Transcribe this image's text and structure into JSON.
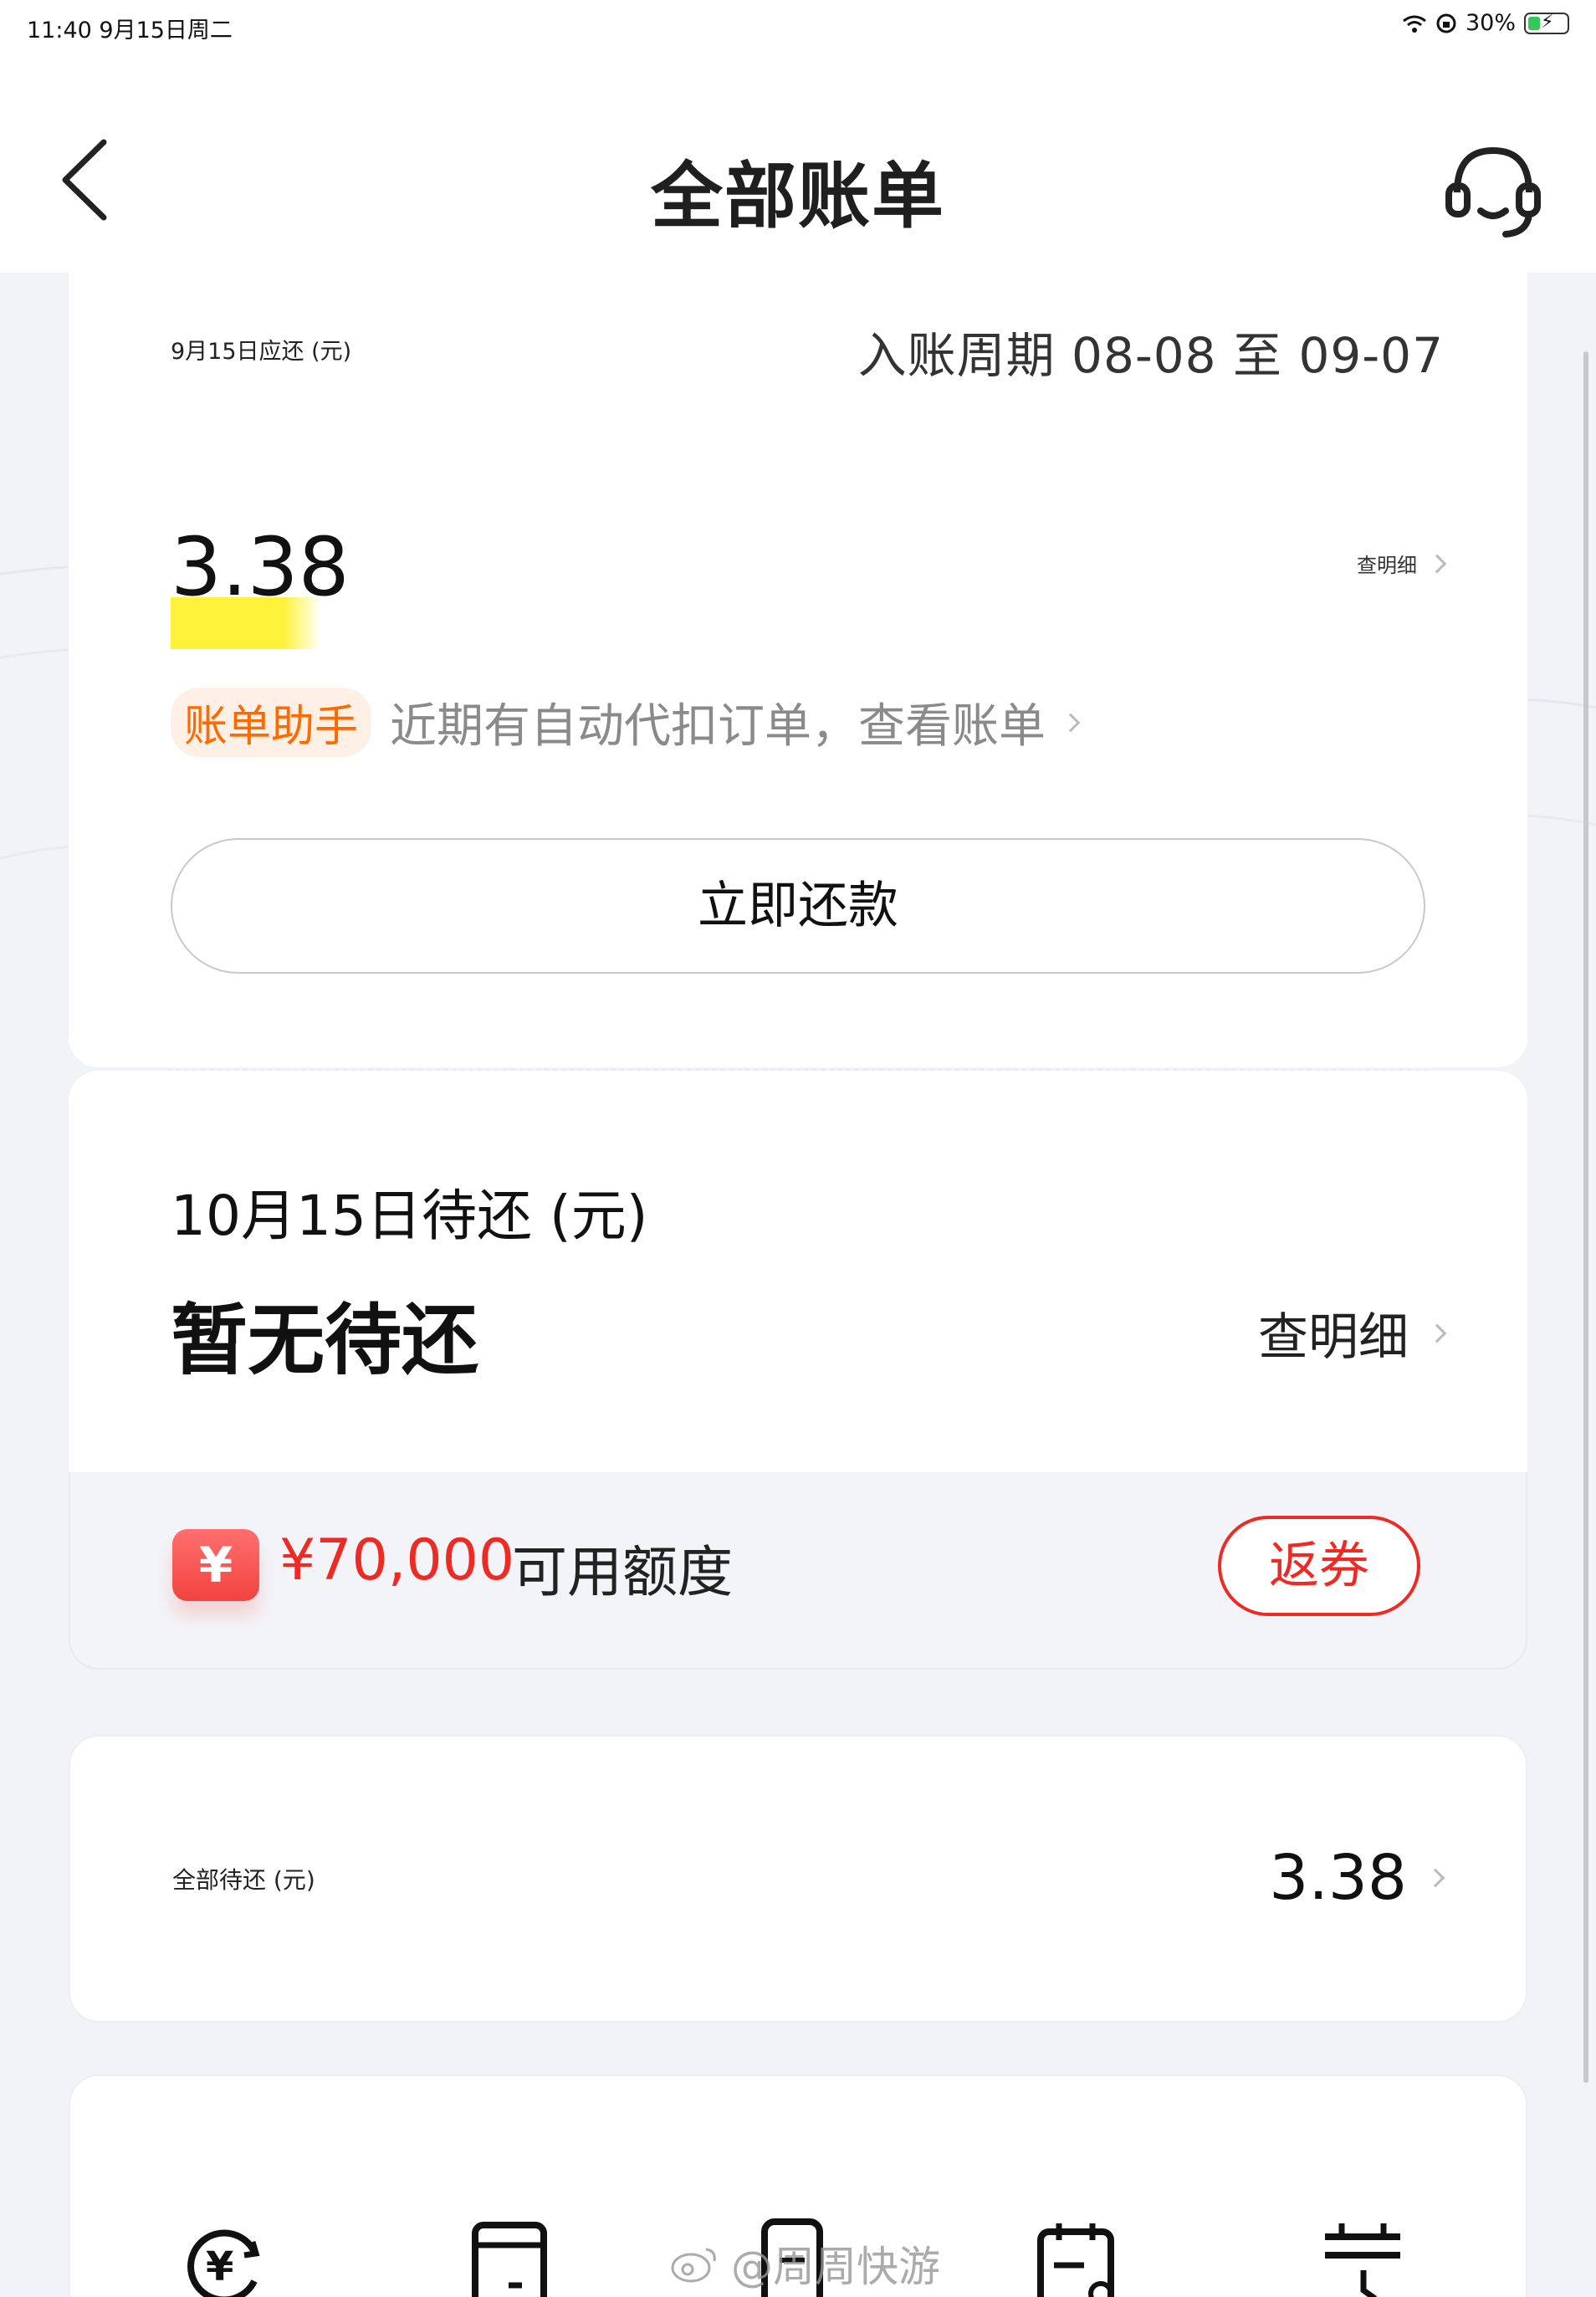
{
  "status_bar": {
    "time": "11:40  9月15日周二",
    "battery": "30%"
  },
  "header": {
    "title": "全部账单",
    "back_icon": "back-chevron-icon",
    "service_icon": "headset-customer-service-icon"
  },
  "current_bill": {
    "due_label": "9月15日应还 (元)",
    "cycle": "入账周期 08-08 至 09-07",
    "amount": "3.38",
    "detail_link": "查明细",
    "assistant_badge": "账单助手",
    "assistant_text": "近期有自动代扣订单，查看账单",
    "pay_button": "立即还款"
  },
  "next_bill": {
    "label": "10月15日待还 (元)",
    "value": "暂无待还",
    "detail_link": "查明细"
  },
  "credit": {
    "icon_text": "¥",
    "amount": "¥70,000",
    "label": "可用额度",
    "coupon_button": "返券"
  },
  "total": {
    "label": "全部待还 (元)",
    "value": "3.38"
  },
  "quick_icons": [
    {
      "name": "repay-yen-icon"
    },
    {
      "name": "card-icon"
    },
    {
      "name": "phone-icon"
    },
    {
      "name": "calendar-edit-icon"
    },
    {
      "name": "calendar-clock-icon"
    }
  ],
  "watermark": "@周周快游",
  "colors": {
    "accent_red": "#ee2a24",
    "assistant_orange": "#ff6a00",
    "highlight_yellow": "#fff23a"
  }
}
